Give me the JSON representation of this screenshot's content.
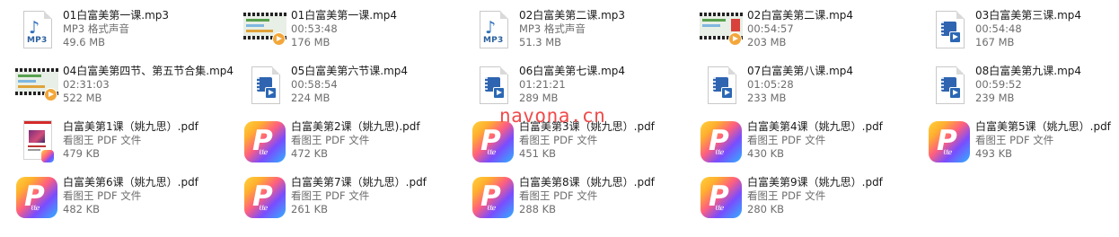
{
  "watermark": "navona.cn",
  "files": [
    {
      "name": "01白富美第一课.mp3",
      "sub1": "MP3 格式声音",
      "sub2": "49.6 MB",
      "icon": "mp3-file-icon"
    },
    {
      "name": "01白富美第一课.mp4",
      "sub1": "00:53:48",
      "sub2": "176 MB",
      "icon": "video-thumbnail-icon"
    },
    {
      "name": "02白富美第二课.mp3",
      "sub1": "MP3 格式声音",
      "sub2": "51.3 MB",
      "icon": "mp3-file-icon"
    },
    {
      "name": "02白富美第二课.mp4",
      "sub1": "00:54:57",
      "sub2": "203 MB",
      "icon": "video-thumbnail-icon"
    },
    {
      "name": "03白富美第三课.mp4",
      "sub1": "00:54:48",
      "sub2": "167 MB",
      "icon": "video-file-icon"
    },
    {
      "name": "04白富美第四节、第五节合集.mp4",
      "sub1": "02:31:03",
      "sub2": "522 MB",
      "icon": "video-thumbnail-icon"
    },
    {
      "name": "05白富美第六节课.mp4",
      "sub1": "00:58:54",
      "sub2": "224 MB",
      "icon": "video-file-icon"
    },
    {
      "name": "06白富美第七课.mp4",
      "sub1": "01:21:21",
      "sub2": "289 MB",
      "icon": "video-file-icon"
    },
    {
      "name": "07白富美第八课.mp4",
      "sub1": "01:05:28",
      "sub2": "233 MB",
      "icon": "video-file-icon"
    },
    {
      "name": "08白富美第九课.mp4",
      "sub1": "00:59:52",
      "sub2": "239 MB",
      "icon": "video-file-icon"
    },
    {
      "name": "白富美第1课（姚九思）.pdf",
      "sub1": "看图王 PDF 文件",
      "sub2": "479 KB",
      "icon": "pdf-cover-icon"
    },
    {
      "name": "白富美第2课（姚九思).pdf",
      "sub1": "看图王 PDF 文件",
      "sub2": "472 KB",
      "icon": "pdf-app-icon"
    },
    {
      "name": "白富美第3课（姚九思）.pdf",
      "sub1": "看图王 PDF 文件",
      "sub2": "451 KB",
      "icon": "pdf-app-icon"
    },
    {
      "name": "白富美第4课（姚九思）.pdf",
      "sub1": "看图王 PDF 文件",
      "sub2": "430 KB",
      "icon": "pdf-app-icon"
    },
    {
      "name": "白富美第5课（姚九思）.pdf",
      "sub1": "看图王 PDF 文件",
      "sub2": "493 KB",
      "icon": "pdf-app-icon"
    },
    {
      "name": "白富美第6课（姚九思）.pdf",
      "sub1": "看图王 PDF 文件",
      "sub2": "482 KB",
      "icon": "pdf-app-icon"
    },
    {
      "name": "白富美第7课（姚九思）.pdf",
      "sub1": "看图王 PDF 文件",
      "sub2": "261 KB",
      "icon": "pdf-app-icon"
    },
    {
      "name": "白富美第8课（姚九思）.pdf",
      "sub1": "看图王 PDF 文件",
      "sub2": "288 KB",
      "icon": "pdf-app-icon"
    },
    {
      "name": "白富美第9课（姚九思）.pdf",
      "sub1": "看图王 PDF 文件",
      "sub2": "280 KB",
      "icon": "pdf-app-icon"
    }
  ]
}
